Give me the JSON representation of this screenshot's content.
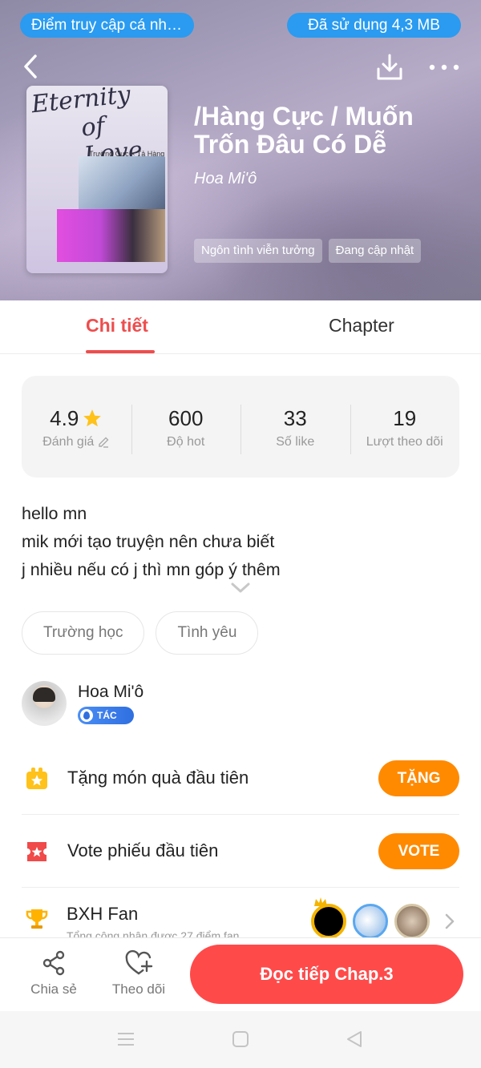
{
  "status": {
    "access_point": "Điểm truy cập cá nhân",
    "data_used": "Đã sử dụng  4,3 MB"
  },
  "header": {
    "back_icon": "chevron-left-icon",
    "download_icon": "download-icon",
    "more_icon": "more-horizontal-icon"
  },
  "book": {
    "cover_title_line1": "Eternity",
    "cover_title_line2": "of Love",
    "cover_subtitle": "Trường Cực × Tả Hàng",
    "title": "/Hàng Cực / Muốn Trốn Đâu Có Dễ",
    "author": "Hoa Mi'ô",
    "tags": [
      "Ngôn tình viễn tưởng",
      "Đang cập nhật"
    ]
  },
  "tabs": {
    "details": "Chi tiết",
    "chapter": "Chapter"
  },
  "stats": [
    {
      "value": "4.9",
      "label": "Đánh giá"
    },
    {
      "value": "600",
      "label": "Độ hot"
    },
    {
      "value": "33",
      "label": "Số like"
    },
    {
      "value": "19",
      "label": "Lượt theo dõi"
    }
  ],
  "description": [
    "hello mn",
    "mik mới tạo truyện nên chưa biết",
    "j nhiều nếu có j thì mn góp ý thêm"
  ],
  "genres": [
    "Trường học",
    "Tình yêu"
  ],
  "author": {
    "name": "Hoa Mi'ô",
    "badge": "TÁC GIẢ"
  },
  "actions": {
    "gift_label": "Tặng món quà đầu tiên",
    "gift_button": "TẶNG",
    "vote_label": "Vote phiếu đầu tiên",
    "vote_button": "VOTE",
    "fan_label": "BXH Fan",
    "fan_sub": "Tổng cộng nhận được 27 điểm fan"
  },
  "bottom": {
    "share": "Chia sẻ",
    "follow": "Theo dõi",
    "read": "Đọc tiếp Chap.3"
  },
  "colors": {
    "accent_red": "#ee4d4d",
    "read_button": "#ff4a4a",
    "action_orange": "#ff8a00",
    "status_blue": "#2a9bf0"
  }
}
